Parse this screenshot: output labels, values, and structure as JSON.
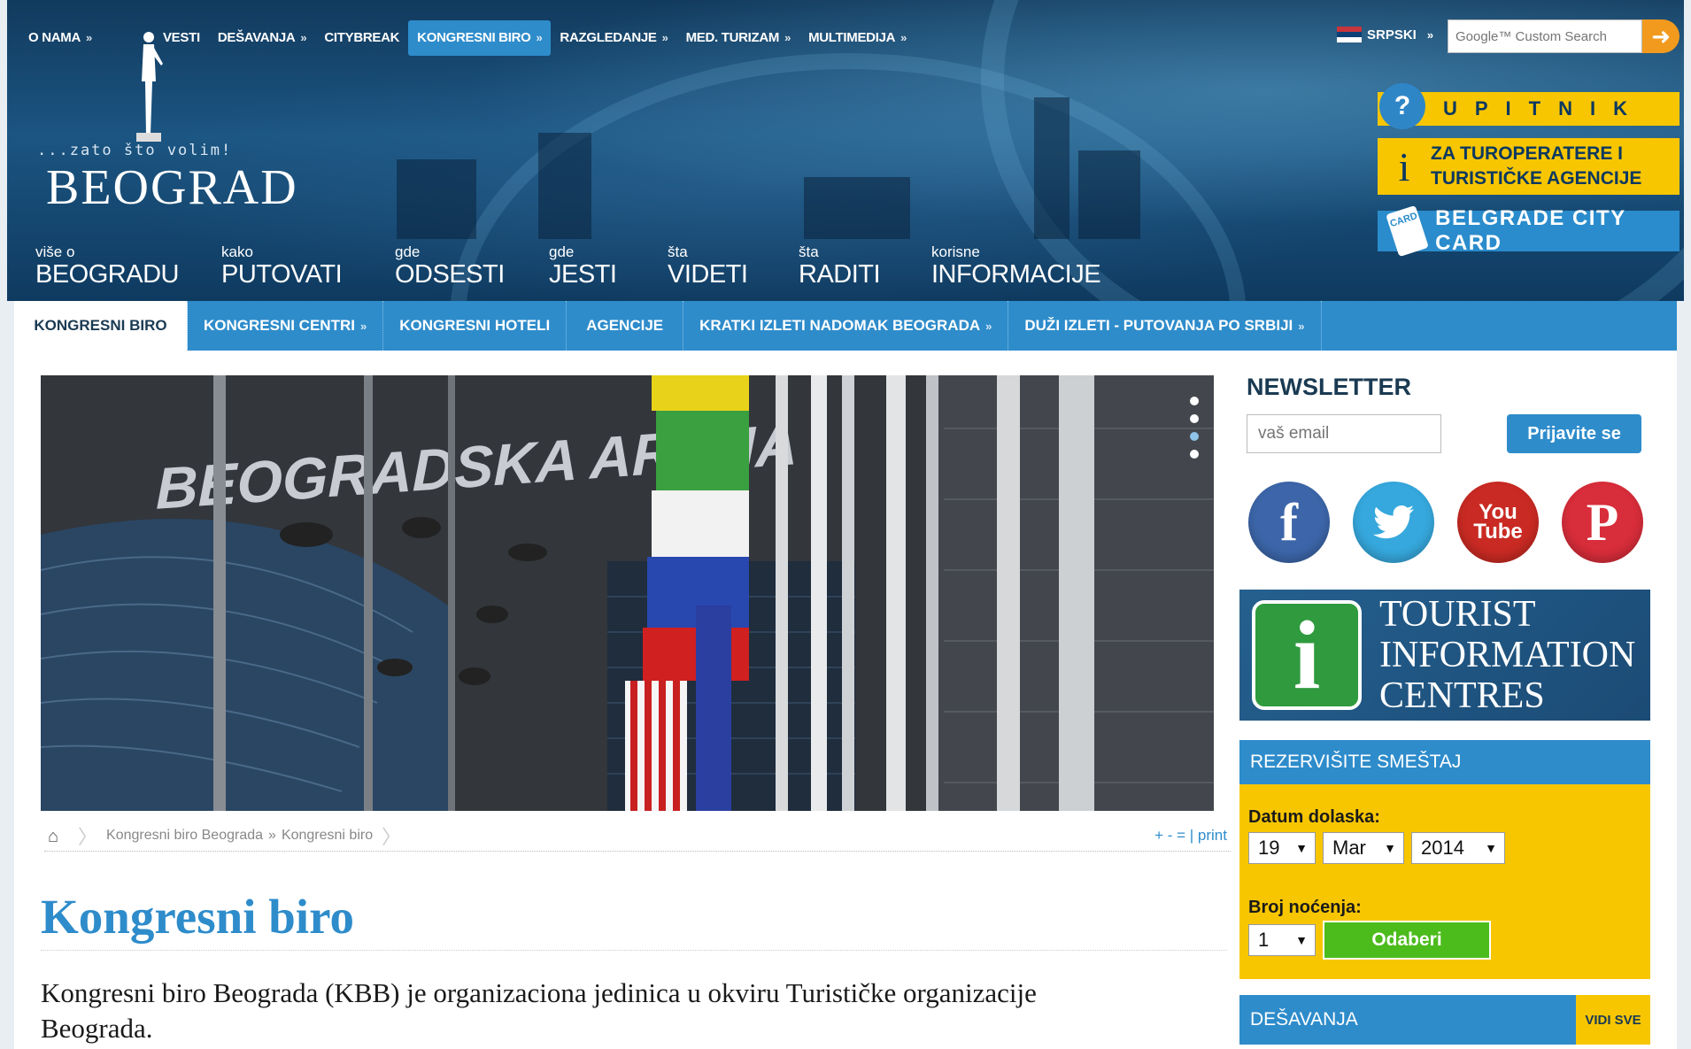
{
  "topnav": {
    "items": [
      {
        "label": "O NAMA",
        "chevron": true
      },
      {
        "label": "VESTI",
        "chevron": false
      },
      {
        "label": "DEŠAVANJA",
        "chevron": true
      },
      {
        "label": "CITYBREAK",
        "chevron": false
      },
      {
        "label": "KONGRESNI BIRO",
        "chevron": true,
        "active": true
      },
      {
        "label": "RAZGLEDANJE",
        "chevron": true
      },
      {
        "label": "MED. TURIZAM",
        "chevron": true
      },
      {
        "label": "MULTIMEDIJA",
        "chevron": true
      }
    ],
    "chevron_glyph": "»"
  },
  "logo": {
    "tagline": "...zato što volim!",
    "brand": "BEOGRAD"
  },
  "language": {
    "label": "SRPSKI"
  },
  "search": {
    "placeholder": "Google™ Custom Search"
  },
  "promos": {
    "upitnik": "UPITNIK",
    "turoperatere_line1": "ZA TUROPERATERE I",
    "turoperatere_line2": "TURISTIČKE AGENCIJE",
    "citycard": "BELGRADE CITY CARD",
    "card_badge": "CARD"
  },
  "mainnav": [
    {
      "small": "više o",
      "big": "BEOGRADU"
    },
    {
      "small": "kako",
      "big": "PUTOVATI"
    },
    {
      "small": "gde",
      "big": "ODSESTI"
    },
    {
      "small": "gde",
      "big": "JESTI"
    },
    {
      "small": "šta",
      "big": "VIDETI"
    },
    {
      "small": "šta",
      "big": "RADITI"
    },
    {
      "small": "korisne",
      "big": "INFORMACIJE"
    }
  ],
  "subnav": [
    {
      "label": "KONGRESNI BIRO",
      "active": true
    },
    {
      "label": "KONGRESNI CENTRI",
      "chevron": true
    },
    {
      "label": "KONGRESNI HOTELI"
    },
    {
      "label": "AGENCIJE"
    },
    {
      "label": "KRATKI IZLETI NADOMAK BEOGRADA",
      "chevron": true
    },
    {
      "label": "DUŽI IZLETI - PUTOVANJA PO SRBIJI",
      "chevron": true
    }
  ],
  "hero": {
    "sign_text": "BEOGRADSKA ARENA"
  },
  "breadcrumb": {
    "items": [
      "Kongresni biro Beograda",
      "Kongresni biro"
    ],
    "separator": "»",
    "tools": "+ - = | print"
  },
  "page": {
    "title": "Kongresni biro",
    "intro": "Kongresni biro Beograda (KBB) je organizaciona jedinica u okviru Turističke organizacije Beograda."
  },
  "newsletter": {
    "title": "NEWSLETTER",
    "placeholder": "vaš email",
    "button": "Prijavite se"
  },
  "social": {
    "facebook": "f",
    "youtube_line1": "You",
    "youtube_line2": "Tube",
    "pinterest": "P"
  },
  "tic": {
    "line1": "TOURIST",
    "line2": "INFORMATION",
    "line3": "CENTRES",
    "icon": "i"
  },
  "booking": {
    "title": "REZERVIŠITE SMEŠTAJ",
    "arrival_label": "Datum dolaska:",
    "day": "19",
    "month": "Mar",
    "year": "2014",
    "nights_label": "Broj noćenja:",
    "nights": "1",
    "submit": "Odaberi"
  },
  "events": {
    "title": "DEŠAVANJA",
    "see_all": "VIDI SVE"
  },
  "colors": {
    "accent": "#2e8ccb",
    "promo_yellow": "#f8c600",
    "header_dark": "#123a5e",
    "submit_green": "#4cbc1c"
  }
}
